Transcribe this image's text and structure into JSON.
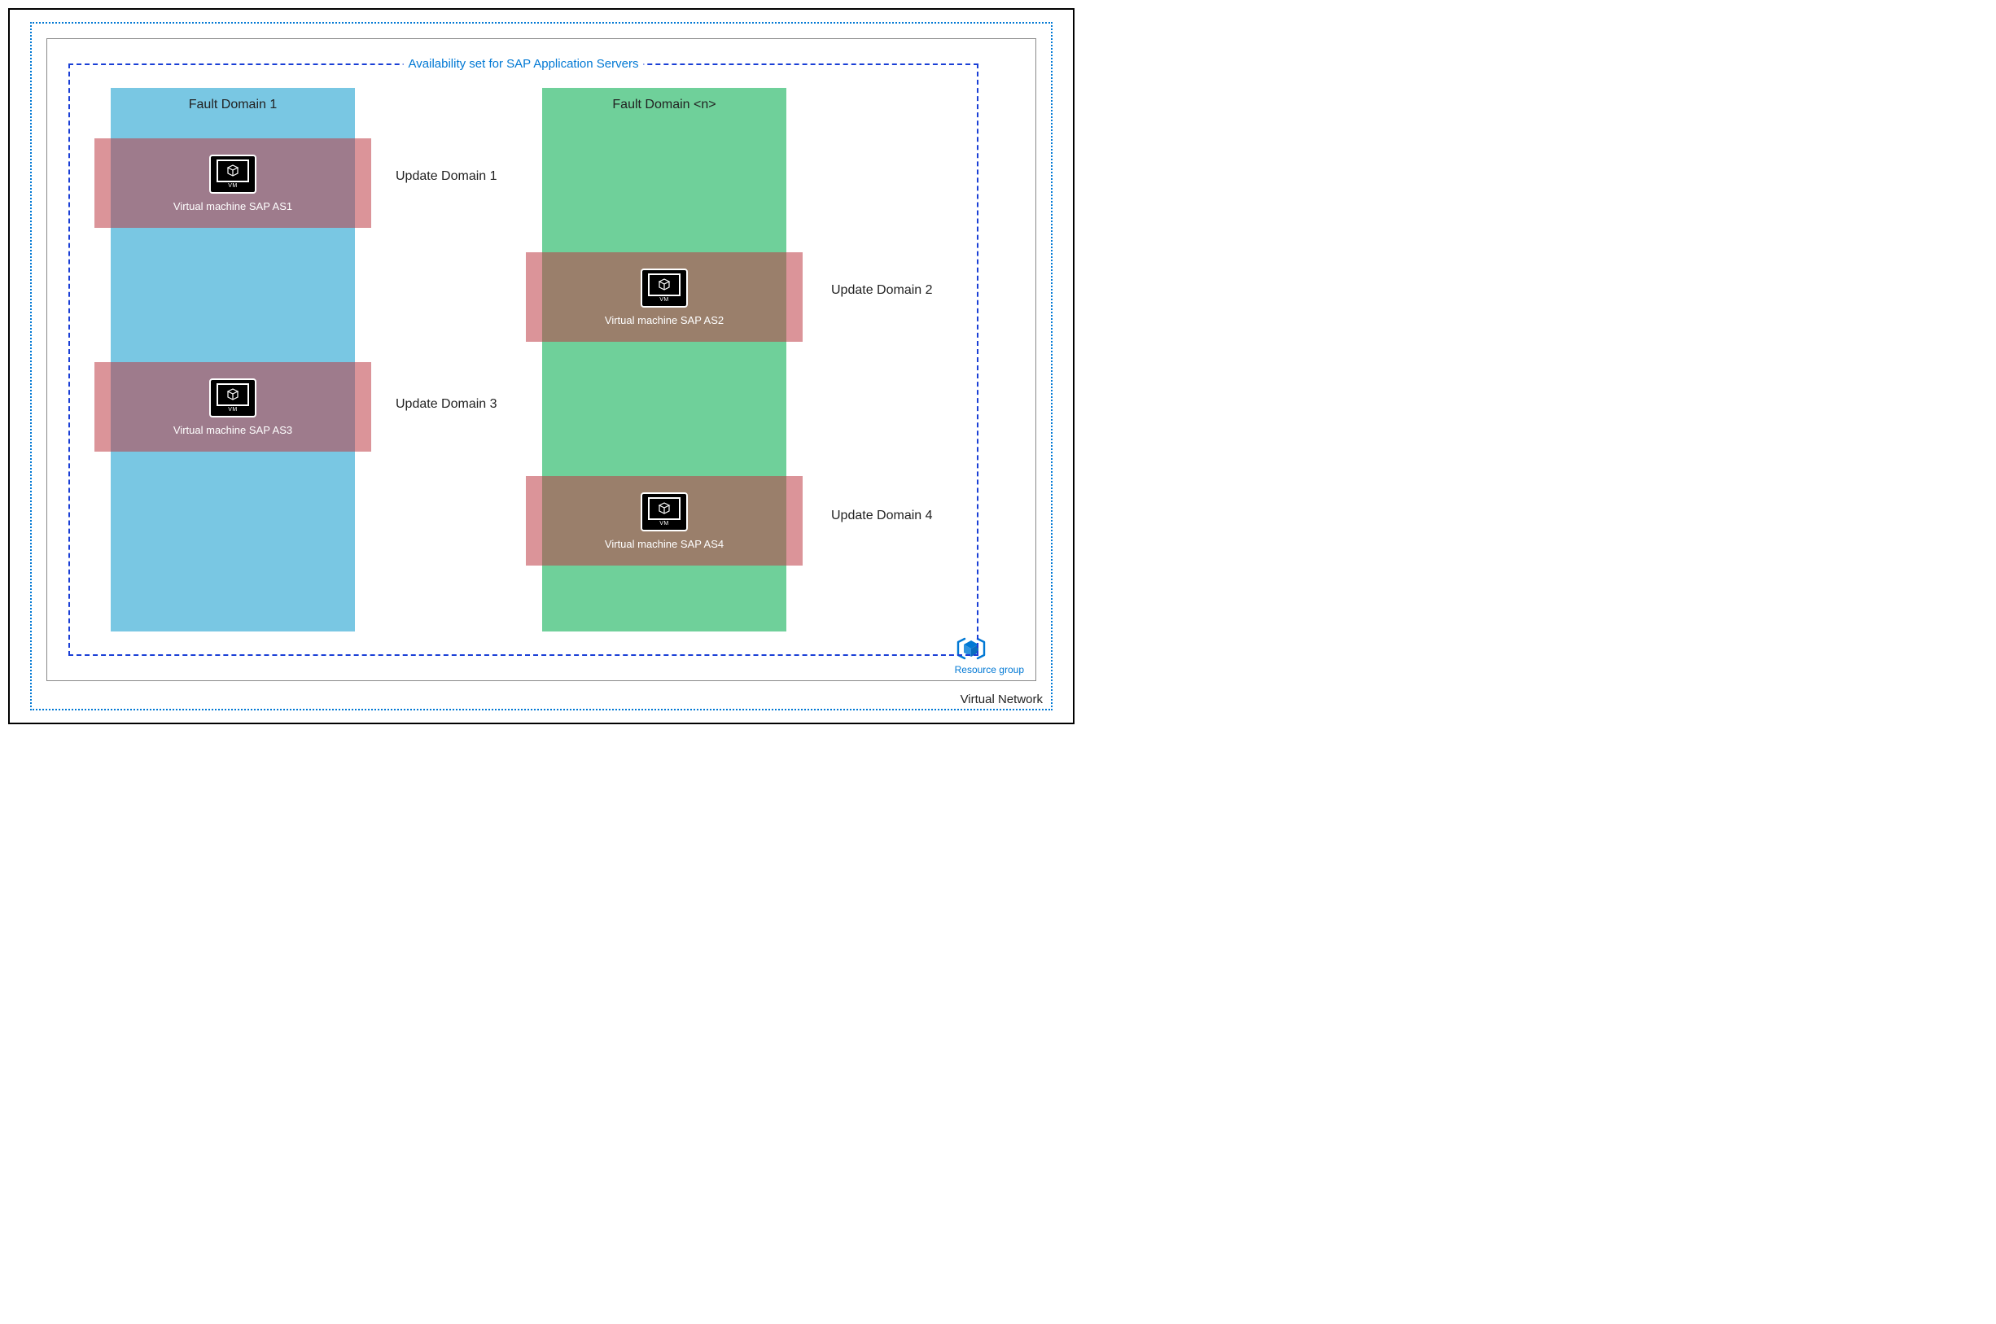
{
  "labels": {
    "virtual_network": "Virtual Network",
    "resource_group": "Resource group",
    "availability_set": "Availability set for SAP Application Servers",
    "vm_tag": "VM"
  },
  "fault_domains": {
    "fd1": "Fault Domain 1",
    "fd2": "Fault Domain <n>"
  },
  "update_domains": {
    "ud1": {
      "label": "Update Domain 1",
      "vm": "Virtual machine SAP AS1"
    },
    "ud2": {
      "label": "Update Domain 2",
      "vm": "Virtual machine SAP AS2"
    },
    "ud3": {
      "label": "Update Domain 3",
      "vm": "Virtual machine SAP AS3"
    },
    "ud4": {
      "label": "Update Domain 4",
      "vm": "Virtual machine SAP AS4"
    }
  },
  "colors": {
    "azure_blue": "#0078d4",
    "dash_blue": "#1a3fd6",
    "fd1_bg": "#79c7e3",
    "fd2_bg": "#6fd09a",
    "ud_overlay": "rgba(190,60,70,0.55)"
  }
}
